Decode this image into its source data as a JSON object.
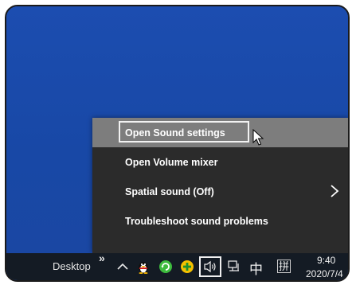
{
  "context_menu": {
    "items": [
      {
        "label": "Open Sound settings"
      },
      {
        "label": "Open Volume mixer"
      },
      {
        "label": "Spatial sound (Off)"
      },
      {
        "label": "Troubleshoot sound problems"
      }
    ]
  },
  "taskbar": {
    "desktop_label": "Desktop",
    "overflow_chevron": "»",
    "ime_mode": "中",
    "ime_layout": "拼",
    "clock_time": "9:40",
    "clock_date": "2020/7/4",
    "tray_icons": [
      "show-hidden-icons-icon",
      "qq-penguin-icon",
      "green-refresh-app-icon",
      "yellow-plus-app-icon",
      "speaker-volume-icon",
      "network-icon"
    ]
  },
  "colors": {
    "desktop_blue": "#1a4aa8",
    "menu_bg": "#2b2b2b",
    "menu_highlight": "#7d7d7d",
    "taskbar_bg": "#141b24"
  }
}
